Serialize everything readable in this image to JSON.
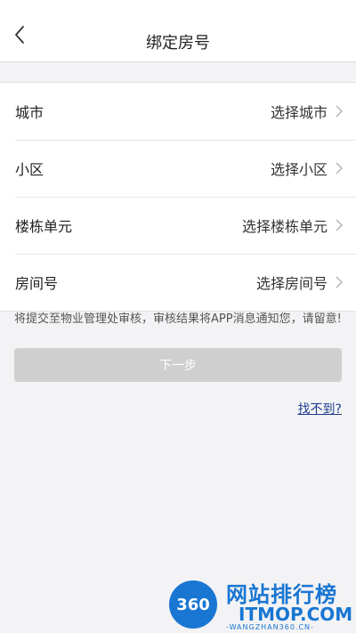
{
  "header": {
    "title": "绑定房号"
  },
  "form": {
    "rows": [
      {
        "label": "城市",
        "value": "选择城市"
      },
      {
        "label": "小区",
        "value": "选择小区"
      },
      {
        "label": "楼栋单元",
        "value": "选择楼栋单元"
      },
      {
        "label": "房间号",
        "value": "选择房间号"
      }
    ]
  },
  "notice": "将提交至物业管理处审核，审核结果将APP消息通知您，请留意!",
  "next_button": "下一步",
  "cant_find_link": "找不到?",
  "watermark": {
    "badge": "360",
    "title": "网站排行榜",
    "subtitle": "ITMOP.COM",
    "url": "-WANGZHAN360.CN-"
  },
  "colors": {
    "background": "#f3f3f5",
    "link": "#1f3f8f",
    "button_disabled": "#cfcfcf",
    "watermark": "#1976d2"
  }
}
